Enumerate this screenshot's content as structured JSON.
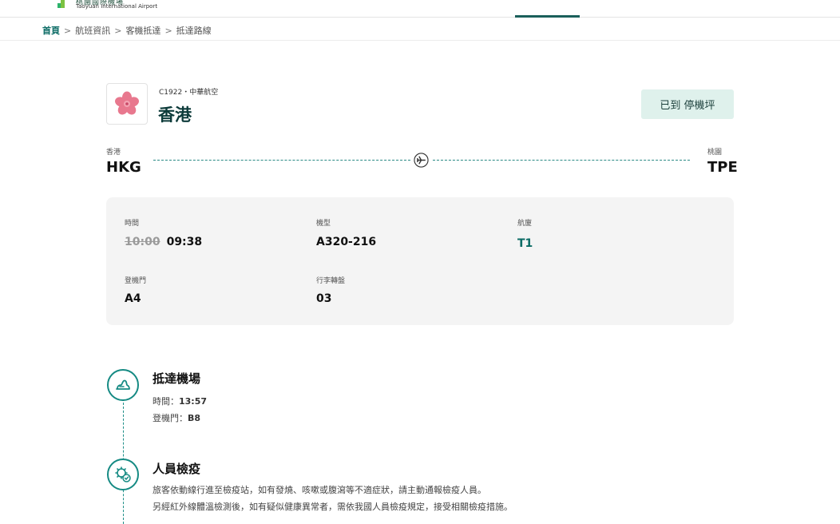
{
  "header": {
    "logo_cn": "桃園國際機場",
    "logo_en": "Taoyuan International Airport"
  },
  "breadcrumb": {
    "home": "首頁",
    "items": [
      "航班資訊",
      "客機抵達",
      "抵達路線"
    ],
    "separator": ">"
  },
  "flight": {
    "code": "C1922・中華航空",
    "destination": "香港",
    "status": "已到 停機坪",
    "airline_logo_icon": "plum-blossom-icon",
    "accent_color": "#0b6b65"
  },
  "route": {
    "from_city": "香港",
    "from_code": "HKG",
    "to_city": "桃園",
    "to_code": "TPE"
  },
  "details": {
    "time_label": "時間",
    "time_scheduled": "10:00",
    "time_actual": "09:38",
    "aircraft_label": "機型",
    "aircraft_value": "A320-216",
    "terminal_label": "航廈",
    "terminal_value": "T1",
    "gate_label": "登機門",
    "gate_value": "A4",
    "baggage_label": "行李轉盤",
    "baggage_value": "03"
  },
  "timeline": [
    {
      "title": "抵達機場",
      "time_label": "時間：",
      "time_value": "13:57",
      "gate_label": "登機門：",
      "gate_value": "B8",
      "icon": "footprint-icon"
    },
    {
      "title": "人員檢疫",
      "line1": "旅客依動線行進至檢疫站，如有發燒、咳嗽或腹瀉等不適症狀，請主動通報檢疫人員。",
      "line2": "另經紅外線體溫檢測後，如有疑似健康異常者，需依我國人員檢疫規定，接受相關檢疫措施。",
      "icon": "virus-shield-icon"
    }
  ]
}
